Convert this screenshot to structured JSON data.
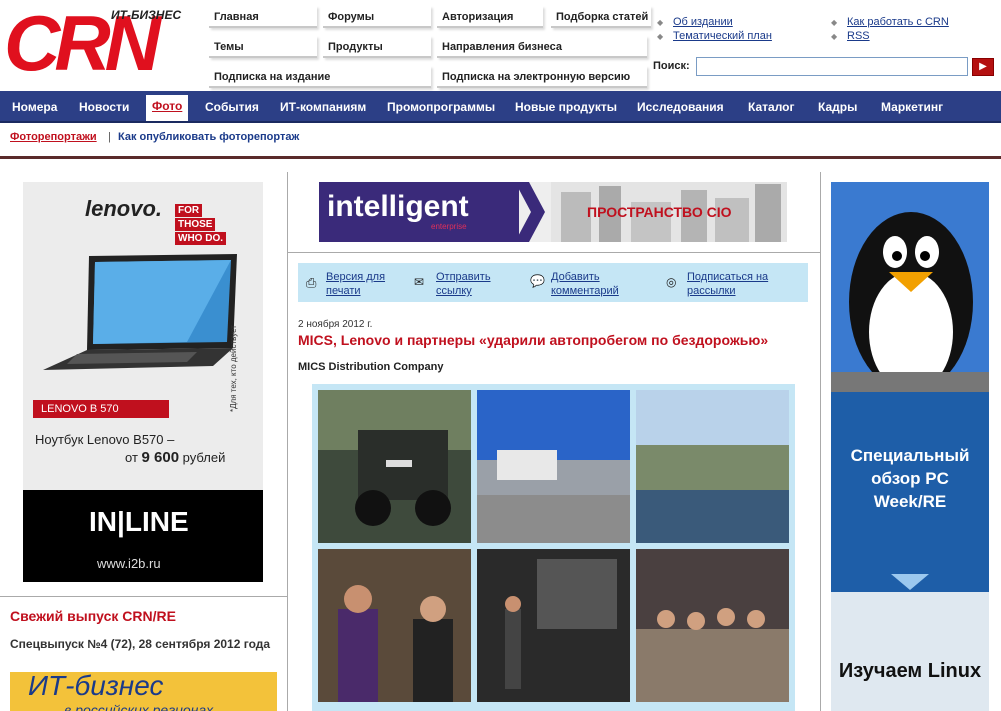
{
  "logo": {
    "sub": "ИТ-БИЗНЕС",
    "text": "CRN"
  },
  "topmenu": [
    {
      "label": "Главная"
    },
    {
      "label": "Форумы"
    },
    {
      "label": "Авторизация"
    },
    {
      "label": "Подборка статей"
    },
    {
      "label": "Темы"
    },
    {
      "label": "Продукты"
    },
    {
      "label": "Направления бизнеса"
    },
    {
      "label": "Подписка на издание"
    },
    {
      "label": "Подписка на электронную версию"
    }
  ],
  "toplinks": [
    {
      "label": "Об издании"
    },
    {
      "label": "Тематический план"
    },
    {
      "label": "Как работать с CRN"
    },
    {
      "label": "RSS"
    }
  ],
  "search": {
    "label": "Поиск:",
    "value": "",
    "button": "▶"
  },
  "nav": [
    {
      "label": "Номера"
    },
    {
      "label": "Новости"
    },
    {
      "label": "Фото"
    },
    {
      "label": "События"
    },
    {
      "label": "ИТ-компаниям"
    },
    {
      "label": "Промопрограммы"
    },
    {
      "label": "Новые продукты"
    },
    {
      "label": "Исследования"
    },
    {
      "label": "Каталог"
    },
    {
      "label": "Кадры"
    },
    {
      "label": "Маркетинг"
    }
  ],
  "subnav": {
    "active": "Фоторепортажи",
    "sep": "|",
    "other": "Как опубликовать фоторепортаж"
  },
  "left_ad": {
    "brand": "lenovo.",
    "slogan1": "FOR",
    "slogan2": "THOSE",
    "slogan3": "WHO DO.",
    "model": "LENOVO B 570",
    "desc1": "Ноутбук Lenovo B570 –",
    "desc2_pre": "от ",
    "price": "9 600",
    "desc2_post": " рублей",
    "side_note": "*Для тех, кто действует",
    "brand2": "IN|LINE",
    "url": "www.i2b.ru"
  },
  "fresh": {
    "title": "Свежий выпуск CRN/RE",
    "issue": "Спецвыпуск №4 (72), 28 сентября 2012 года",
    "cover1": "ИТ-бизнес",
    "cover2": "в российских регионах"
  },
  "banner": {
    "brand": "intelligent",
    "brand_sub": "enterprise",
    "tagline": "ПРОСТРАНСТВО CIO"
  },
  "tools": [
    {
      "label": "Версия для печати"
    },
    {
      "label": "Отправить ссылку"
    },
    {
      "label": "Добавить комментарий"
    },
    {
      "label": "Подписаться на рассылки"
    }
  ],
  "article": {
    "date": "2 ноября 2012 г.",
    "title": "MICS, Lenovo и партнеры «ударили автопробегом по бездорожью»",
    "source": "MICS Distribution Company"
  },
  "right_ad": {
    "text1": "Специальный обзор PC Week/RE",
    "text2": "Изучаем Linux"
  },
  "colors": {
    "nav": "#2c3f86",
    "accent": "#c0101e",
    "toolbar": "#c5e6f5"
  }
}
